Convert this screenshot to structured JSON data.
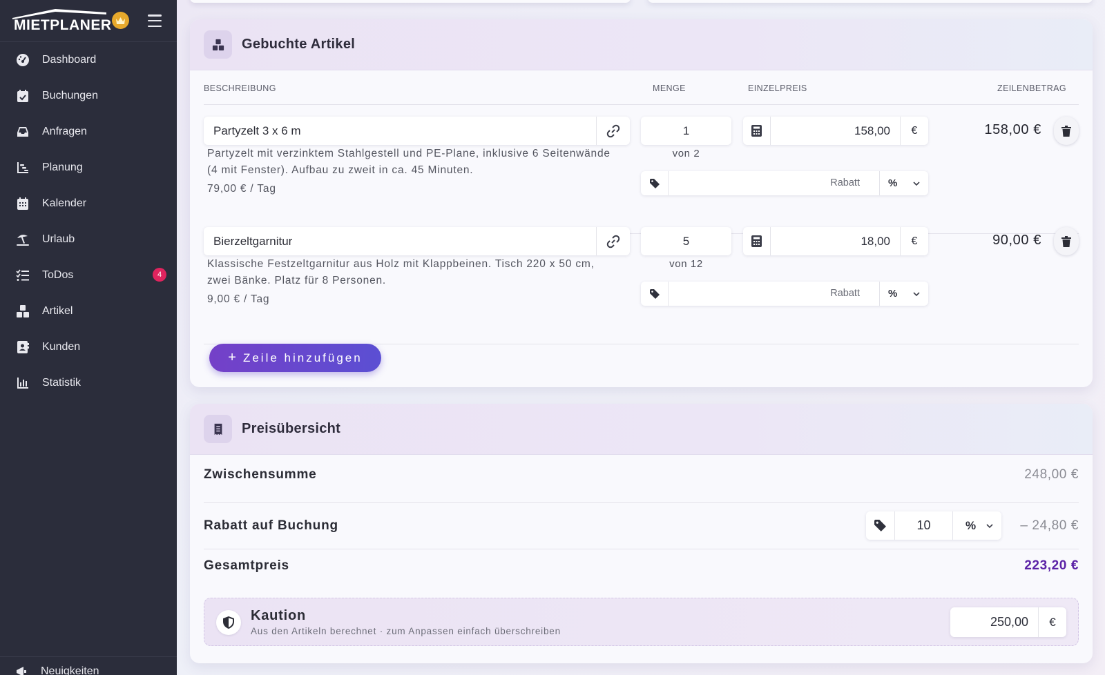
{
  "app": {
    "logo_text": "MIETPLANER"
  },
  "sidebar": {
    "items": [
      {
        "label": "Dashboard",
        "icon": "dashboard-icon"
      },
      {
        "label": "Buchungen",
        "icon": "calendar-check-icon"
      },
      {
        "label": "Anfragen",
        "icon": "inbox-icon"
      },
      {
        "label": "Planung",
        "icon": "timeline-icon"
      },
      {
        "label": "Kalender",
        "icon": "calendar-icon"
      },
      {
        "label": "Urlaub",
        "icon": "umbrella-beach-icon"
      },
      {
        "label": "ToDos",
        "icon": "tasks-icon",
        "badge": "4"
      },
      {
        "label": "Artikel",
        "icon": "boxes-icon"
      },
      {
        "label": "Kunden",
        "icon": "contact-card-icon"
      },
      {
        "label": "Statistik",
        "icon": "bar-chart-icon"
      }
    ],
    "bottom_item": {
      "label": "Neuigkeiten",
      "icon": "megaphone-icon"
    }
  },
  "articles": {
    "title": "Gebuchte Artikel",
    "headers": {
      "description": "BESCHREIBUNG",
      "quantity": "MENGE",
      "unit_price": "EINZELPREIS",
      "line_total": "ZEILENBETRAG"
    },
    "rows": [
      {
        "name": "Partyzelt 3 x 6 m",
        "quantity": "1",
        "availability": "von 2",
        "unit_price": "158,00",
        "currency": "€",
        "discount_placeholder": "Rabatt",
        "discount_unit": "%",
        "description": "Partyzelt mit verzinktem Stahlgestell und PE-Plane, inklusive 6 Seitenwände (4 mit Fenster). Aufbau zu zweit in ca. 45 Minuten.",
        "rate": "79,00 € / Tag",
        "line_total": "158,00 €"
      },
      {
        "name": "Bierzeltgarnitur",
        "quantity": "5",
        "availability": "von 12",
        "unit_price": "18,00",
        "currency": "€",
        "discount_placeholder": "Rabatt",
        "discount_unit": "%",
        "description": "Klassische Festzeltgarnitur aus Holz mit Klappbeinen. Tisch 220 x 50 cm, zwei Bänke. Platz für 8 Personen.",
        "rate": "9,00 € / Tag",
        "line_total": "90,00 €"
      }
    ],
    "add_row_label": "Zeile hinzufügen"
  },
  "summary": {
    "title": "Preisübersicht",
    "subtotal_label": "Zwischensumme",
    "subtotal_value": "248,00 €",
    "booking_discount_label": "Rabatt auf Buchung",
    "booking_discount_value": "10",
    "booking_discount_unit": "%",
    "booking_discount_amount": "– 24,80 €",
    "total_label": "Gesamtpreis",
    "total_value": "223,20 €",
    "deposit": {
      "title": "Kaution",
      "subtitle": "Aus den Artikeln berechnet · zum Anpassen einfach überschreiben",
      "value": "250,00",
      "currency": "€"
    }
  },
  "colors": {
    "sidebar_bg": "#2b2d3b",
    "accent": "#6a45cc",
    "total": "#5b22a6",
    "badge": "#e0245e"
  }
}
